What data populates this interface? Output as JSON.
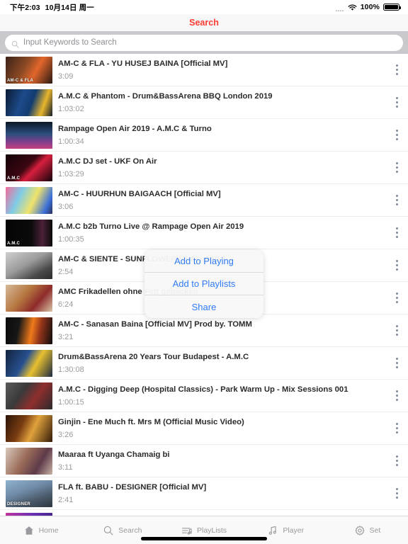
{
  "statusbar": {
    "time": "下午2:03",
    "date": "10月14日 周一",
    "signal_dots": "....",
    "wifi_icon": "wifi-icon",
    "battery_percent": "100%",
    "battery_icon": "battery-full-icon"
  },
  "navbar": {
    "title": "Search",
    "title_color": "#fd3b30"
  },
  "search": {
    "icon": "search-icon",
    "placeholder": "Input Keywords to Search",
    "value": ""
  },
  "list": {
    "rows": [
      {
        "title": "AM-C & FLA - YU HUSEJ BAINA [Official MV]",
        "duration": "3:09",
        "thumb_label": "AM-C & FLA",
        "thumb_gradient": "linear-gradient(120deg,#3b2218 0%,#8d4a24 40%,#e2662b 62%,#2a1a14 100%)"
      },
      {
        "title": "A.M.C & Phantom - Drum&BassArena BBQ London 2019",
        "duration": "1:03:02",
        "thumb_label": "",
        "thumb_gradient": "linear-gradient(110deg,#0b1a33 0%,#1d4b8a 35%,#123b70 55%,#e8b62c 78%,#101b2c 100%)"
      },
      {
        "title": "Rampage Open Air 2019 - A.M.C & Turno",
        "duration": "1:00:34",
        "thumb_label": "",
        "thumb_gradient": "linear-gradient(180deg,#0d1726 0%,#2c4f7d 45%,#7a3f8e 72%,#c3407f 100%)"
      },
      {
        "title": "A.M.C DJ set - UKF On Air",
        "duration": "1:03:29",
        "thumb_label": "A.M.C",
        "thumb_gradient": "linear-gradient(135deg,#120206 0%,#3c0713 45%,#d61e3c 60%,#12040a 100%)"
      },
      {
        "title": "AM-C - HUURHUN BAIGAACH [Official MV]",
        "duration": "3:06",
        "thumb_label": "",
        "thumb_gradient": "linear-gradient(115deg,#f36a9a 0%,#7ecbe8 30%,#f0e36b 58%,#3a6fd8 85%,#2a2f55 100%)"
      },
      {
        "title": "A.M.C b2b Turno Live @ Rampage Open Air 2019",
        "duration": "1:00:35",
        "thumb_label": "A.M.C",
        "thumb_gradient": "linear-gradient(90deg,#050505 0%,#0b0b0b 55%,#4a2139 78%,#0a0a0a 100%)"
      },
      {
        "title": "AM-C & SIENTE - SUNFLOWER [Official MV]",
        "duration": "2:54",
        "thumb_label": "",
        "thumb_gradient": "linear-gradient(150deg,#cfcfcf 0%,#9a9a9a 45%,#4a4a4a 75%,#2b2b2b 100%)"
      },
      {
        "title": "AMC Frikadellen ohne Fett gebacken",
        "duration": "6:24",
        "thumb_label": "",
        "thumb_gradient": "linear-gradient(130deg,#d7b89a 0%,#b5763f 40%,#8e2b2b 68%,#d8c6a8 100%)"
      },
      {
        "title": "AM-C - Sanasan Baina [Official MV] Prod by. TOMM",
        "duration": "3:21",
        "thumb_label": "",
        "thumb_gradient": "linear-gradient(100deg,#0a0a0a 0%,#171717 28%,#f07a1a 55%,#93341a 72%,#0c0c0c 100%)"
      },
      {
        "title": "Drum&BassArena 20 Years Tour Budapest - A.M.C",
        "duration": "1:30:08",
        "thumb_label": "",
        "thumb_gradient": "linear-gradient(120deg,#12233d 0%,#27508f 40%,#e8c02f 62%,#1b2a40 100%)"
      },
      {
        "title": "A.M.C - Digging Deep (Hospital Classics) - Park Warm Up - Mix Sessions 001",
        "duration": "1:00:15",
        "thumb_label": "",
        "thumb_gradient": "linear-gradient(125deg,#5b5b5b 0%,#3a3a3a 35%,#8f2e2e 62%,#2a2a2a 100%)"
      },
      {
        "title": "Ginjin - Ene Much ft. Mrs M (Official Music Video)",
        "duration": "3:26",
        "thumb_label": "",
        "thumb_gradient": "linear-gradient(115deg,#2b1406 0%,#7a3d12 35%,#e0a23c 58%,#321a0a 100%)"
      },
      {
        "title": "Maaraa ft Uyanga Chamaig bi",
        "duration": "3:11",
        "thumb_label": "",
        "thumb_gradient": "linear-gradient(120deg,#d8c9bd 0%,#9b6c58 40%,#5e3a4a 70%,#c9b3a4 100%)"
      },
      {
        "title": "FLA ft. BABU - DESIGNER [Official MV]",
        "duration": "2:41",
        "thumb_label": "DESIGNER",
        "thumb_gradient": "linear-gradient(160deg,#8fb3cf 0%,#6f8aa6 40%,#4a5a6a 70%,#2e3740 100%)"
      },
      {
        "title": "",
        "duration": "",
        "thumb_label": "",
        "thumb_gradient": "linear-gradient(120deg,#c2349c 0%,#6a2fb5 45%,#2a1f6a 100%)"
      }
    ]
  },
  "popup": {
    "items": [
      {
        "label": "Add to Playing"
      },
      {
        "label": "Add to Playlists"
      },
      {
        "label": "Share"
      }
    ],
    "text_color": "#2f7cf6"
  },
  "tabbar": {
    "tabs": [
      {
        "label": "Home",
        "icon": "home-icon"
      },
      {
        "label": "Search",
        "icon": "search-icon"
      },
      {
        "label": "PlayLists",
        "icon": "playlist-icon"
      },
      {
        "label": "Player",
        "icon": "music-note-icon"
      },
      {
        "label": "Set",
        "icon": "gear-icon"
      }
    ]
  }
}
